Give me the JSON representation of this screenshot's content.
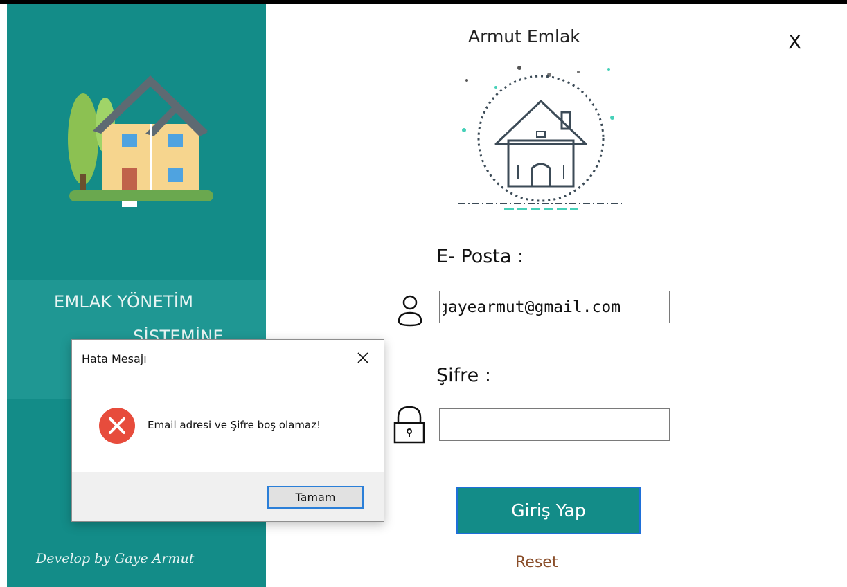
{
  "window": {
    "title": "Armut Emlak",
    "close_label": "X"
  },
  "sidebar": {
    "title_line1": "EMLAK YÖNETİM",
    "title_line2": "SİSTEMİNE",
    "credit": "Develop by Gaye Armut"
  },
  "form": {
    "email_label": "E- Posta :",
    "email_value": "gayearmut@gmail.com",
    "password_label": "Şifre :",
    "password_value": "",
    "login_button": "Giriş Yap",
    "reset_link": "Reset"
  },
  "dialog": {
    "title": "Hata Mesajı",
    "message": "Email adresi ve Şifre boş olamaz!",
    "ok_button": "Tamam"
  },
  "colors": {
    "sidebar": "#138c88",
    "button": "#138c88",
    "reset_link": "#8a4e2a",
    "error_icon": "#e74c3c"
  },
  "icons": {
    "house": "house-illustration-icon",
    "logo": "house-outline-icon",
    "user": "user-icon",
    "lock": "lock-icon",
    "error": "error-icon",
    "close": "close-icon"
  }
}
